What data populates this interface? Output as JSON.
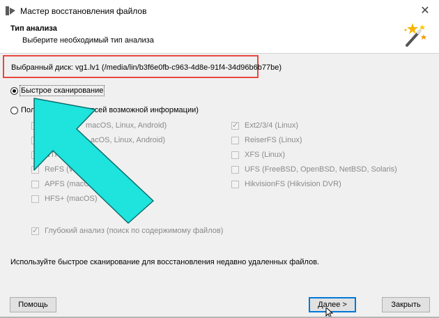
{
  "window": {
    "title": "Мастер восстановления файлов",
    "close_glyph": "✕",
    "app_icon": "wizard-app-icon"
  },
  "header": {
    "title": "Тип анализа",
    "subtitle": "Выберите необходимый тип анализа",
    "icon": "magic-wand-icon"
  },
  "disk": {
    "text": "Выбранный диск: vg1.lv1 (/media/lin/b3f6e0fb-c963-4d8e-91f4-34d96b6b77be)"
  },
  "scan_options": [
    {
      "label": "Быстрое сканирование",
      "selected": true
    },
    {
      "label_left": "Пол",
      "label_right": "к всей возможной информации)",
      "selected": false
    }
  ],
  "filesystems_left": [
    {
      "label": "macOS, Linux, Android)",
      "checked": false
    },
    {
      "label": "acOS, Linux, Android)",
      "checked": false
    },
    {
      "label": "NTFS",
      "checked": false
    },
    {
      "label": "ReFS (Wind",
      "checked": false
    },
    {
      "label": "APFS (macOS)",
      "checked": false
    },
    {
      "label": "HFS+ (macOS)",
      "checked": false
    }
  ],
  "filesystems_right": [
    {
      "label": "Ext2/3/4 (Linux)",
      "checked": true
    },
    {
      "label": "ReiserFS (Linux)",
      "checked": false
    },
    {
      "label": "XFS (Linux)",
      "checked": false
    },
    {
      "label": "UFS (FreeBSD, OpenBSD, NetBSD, Solaris)",
      "checked": false
    },
    {
      "label": "HikvisionFS (Hikvision DVR)",
      "checked": false
    }
  ],
  "deep_analysis": {
    "label": "Глубокий анализ (поиск по содержимому файлов)",
    "checked": true
  },
  "hint": "Используйте быстрое сканирование для восстановления недавно удаленных файлов.",
  "buttons": {
    "help": "Помощь",
    "next": "Далее >",
    "close": "Закрыть"
  },
  "colors": {
    "highlight_box": "#e8473f",
    "arrow": "#1fe3dd",
    "arrow_outline": "#0c6e6c"
  }
}
